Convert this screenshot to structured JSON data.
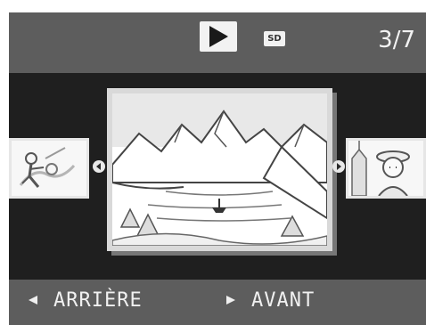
{
  "top_bar": {
    "play_icon": "play-icon",
    "sd_label": "SD",
    "counter": "3/7"
  },
  "thumbnails": {
    "left": {
      "icon": "thumbnail-tennis-player"
    },
    "center": {
      "icon": "thumbnail-mountain-lake"
    },
    "right": {
      "icon": "thumbnail-portrait-hat"
    }
  },
  "bottom_bar": {
    "back_label": "ARRIÈRE",
    "forward_label": "AVANT"
  },
  "colors": {
    "bar_bg": "#5d5d5d",
    "main_bg": "#1f1f1f",
    "text": "#f0f0f0"
  }
}
